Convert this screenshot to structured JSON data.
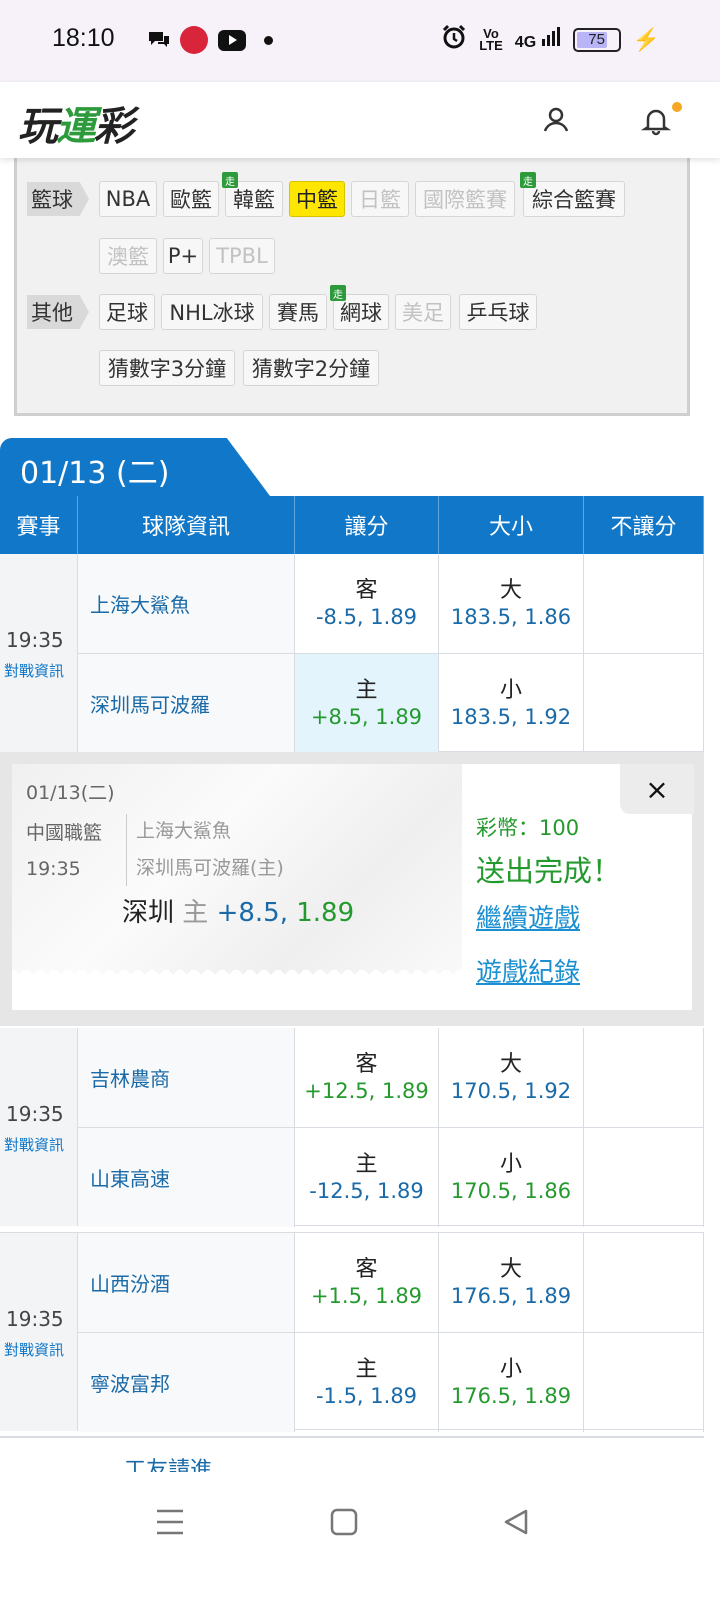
{
  "status_bar": {
    "time": "18:10",
    "battery": "75",
    "net_top": "Vo",
    "net_bottom": "LTE",
    "signal": "4G"
  },
  "header": {
    "logo_text_1": "玩",
    "logo_text_2": "運",
    "logo_text_3": "彩",
    "accent": "#2d9a3b"
  },
  "categories": {
    "basketball_label": "籃球",
    "other_label": "其他",
    "basketball": [
      "NBA",
      "歐籃",
      "韓籃",
      "中籃",
      "日籃",
      "國際籃賽",
      "綜合籃賽",
      "澳籃",
      "P+",
      "TPBL"
    ],
    "other": [
      "足球",
      "NHL冰球",
      "賽馬",
      "網球",
      "美足",
      "乒乓球",
      "猜數字3分鐘",
      "猜數字2分鐘"
    ],
    "live_badge": "走"
  },
  "date_tab": "01/13 (二)",
  "table_header": [
    "賽事",
    "球隊資訊",
    "讓分",
    "大小",
    "不讓分"
  ],
  "games": [
    {
      "time": "19:35",
      "info": "對戰資訊",
      "away": {
        "team": "上海大鯊魚",
        "spread_label": "客",
        "spread": "-8.5, 1.89",
        "total_label": "大",
        "total": "183.5, 1.86"
      },
      "home": {
        "team": "深圳馬可波羅",
        "spread_label": "主",
        "spread": "+8.5, 1.89",
        "total_label": "小",
        "total": "183.5, 1.92"
      }
    },
    {
      "time": "19:35",
      "info": "對戰資訊",
      "away": {
        "team": "吉林農商",
        "spread_label": "客",
        "spread": "+12.5, 1.89",
        "total_label": "大",
        "total": "170.5, 1.92"
      },
      "home": {
        "team": "山東高速",
        "spread_label": "主",
        "spread": "-12.5, 1.89",
        "total_label": "小",
        "total": "170.5, 1.86"
      }
    },
    {
      "time": "19:35",
      "info": "對戰資訊",
      "away": {
        "team": "山西汾酒",
        "spread_label": "客",
        "spread": "+1.5, 1.89",
        "total_label": "大",
        "total": "176.5, 1.89"
      },
      "home": {
        "team": "寧波富邦",
        "spread_label": "主",
        "spread": "-1.5, 1.89",
        "total_label": "小",
        "total": "176.5, 1.89"
      }
    }
  ],
  "popup": {
    "date": "01/13(二)",
    "league": "中國職籃",
    "time": "19:35",
    "team1": "上海大鯊魚",
    "team2": "深圳馬可波羅(主)",
    "bet_team": "深圳",
    "bet_side": "主",
    "bet_line": "+8.5,",
    "bet_price": "1.89",
    "coins": "彩幣：100",
    "done": "送出完成！",
    "continue_link": "繼續遊戲",
    "history_link": "遊戲紀錄",
    "close": "×"
  },
  "next_league": "工友請進"
}
